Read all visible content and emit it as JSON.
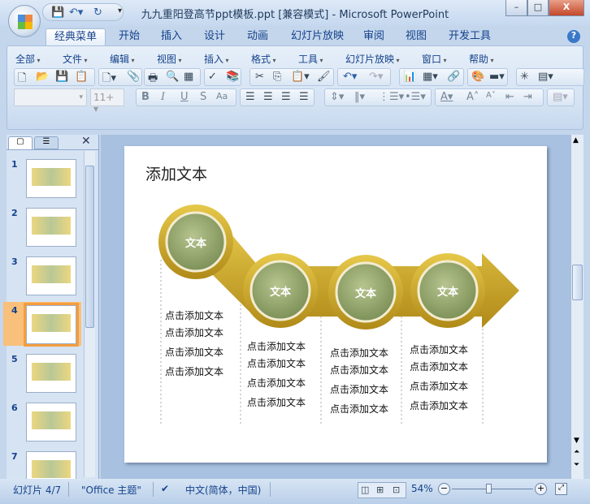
{
  "window": {
    "title": "九九重阳登高节ppt模板.ppt [兼容模式] - Microsoft PowerPoint",
    "minimize": "–",
    "maximize": "□",
    "close": "X"
  },
  "tabs": [
    "经典菜单",
    "开始",
    "插入",
    "设计",
    "动画",
    "幻灯片放映",
    "审阅",
    "视图",
    "开发工具"
  ],
  "menus": [
    "全部",
    "文件",
    "编辑",
    "视图",
    "插入",
    "格式",
    "工具",
    "幻灯片放映",
    "窗口",
    "帮助"
  ],
  "font": {
    "name": "",
    "size": "11+"
  },
  "format_buttons": [
    "B",
    "I",
    "U",
    "S",
    "Aa"
  ],
  "pane": {
    "close": "✕"
  },
  "thumbnails": [
    "1",
    "2",
    "3",
    "4",
    "5",
    "6",
    "7"
  ],
  "selected_slide": 4,
  "slide": {
    "title": "添加文本",
    "circles": [
      "文本",
      "文本",
      "文本",
      "文本"
    ],
    "columns": [
      [
        "点击添加文本",
        "点击添加文本",
        "点击添加文本",
        "点击添加文本"
      ],
      [
        "点击添加文本",
        "点击添加文本",
        "点击添加文本",
        "点击添加文本"
      ],
      [
        "点击添加文本",
        "点击添加文本",
        "点击添加文本",
        "点击添加文本"
      ],
      [
        "点击添加文本",
        "点击添加文本",
        "点击添加文本",
        "点击添加文本"
      ]
    ],
    "colors": {
      "gold": "#c9a32a",
      "circle": "#8ea36a"
    }
  },
  "status": {
    "slide": "幻灯片 4/7",
    "theme": "\"Office 主题\"",
    "language": "中文(简体，中国)",
    "zoom": "54%",
    "zoom_fraction": 0.45
  }
}
